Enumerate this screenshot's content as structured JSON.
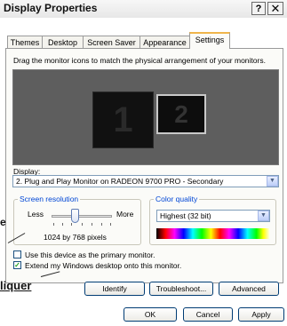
{
  "window": {
    "title": "Display Properties",
    "help_label": "?",
    "close_label": "✕"
  },
  "tabs": [
    {
      "label": "Themes"
    },
    {
      "label": "Desktop"
    },
    {
      "label": "Screen Saver"
    },
    {
      "label": "Appearance"
    },
    {
      "label": "Settings",
      "active": true
    }
  ],
  "settings": {
    "instruction": "Drag the monitor icons to match the physical arrangement of your monitors.",
    "monitor_1": "1",
    "monitor_2": "2",
    "display_label": "Display:",
    "display_value": "2. Plug and Play Monitor on RADEON 9700 PRO - Secondary",
    "screen_resolution": {
      "title": "Screen resolution",
      "less": "Less",
      "more": "More",
      "value": "1024 by 768 pixels"
    },
    "color_quality": {
      "title": "Color quality",
      "value": "Highest (32 bit)"
    },
    "primary_checkbox": {
      "label": "Use this device as the primary monitor.",
      "checked": false
    },
    "extend_checkbox": {
      "label": "Extend my Windows desktop onto this monitor.",
      "checked": true
    },
    "buttons": {
      "identify": "Identify",
      "troubleshoot": "Troubleshoot...",
      "advanced": "Advanced"
    }
  },
  "dialog_buttons": {
    "ok": "OK",
    "cancel": "Cancel",
    "apply": "Apply"
  },
  "annotations": {
    "side_text": "e",
    "cliquer": "liquer"
  },
  "colors": {
    "accent_tab": "#f0b54b",
    "group_title": "#0046d5",
    "monitor_bg": "#5e5e5e"
  }
}
